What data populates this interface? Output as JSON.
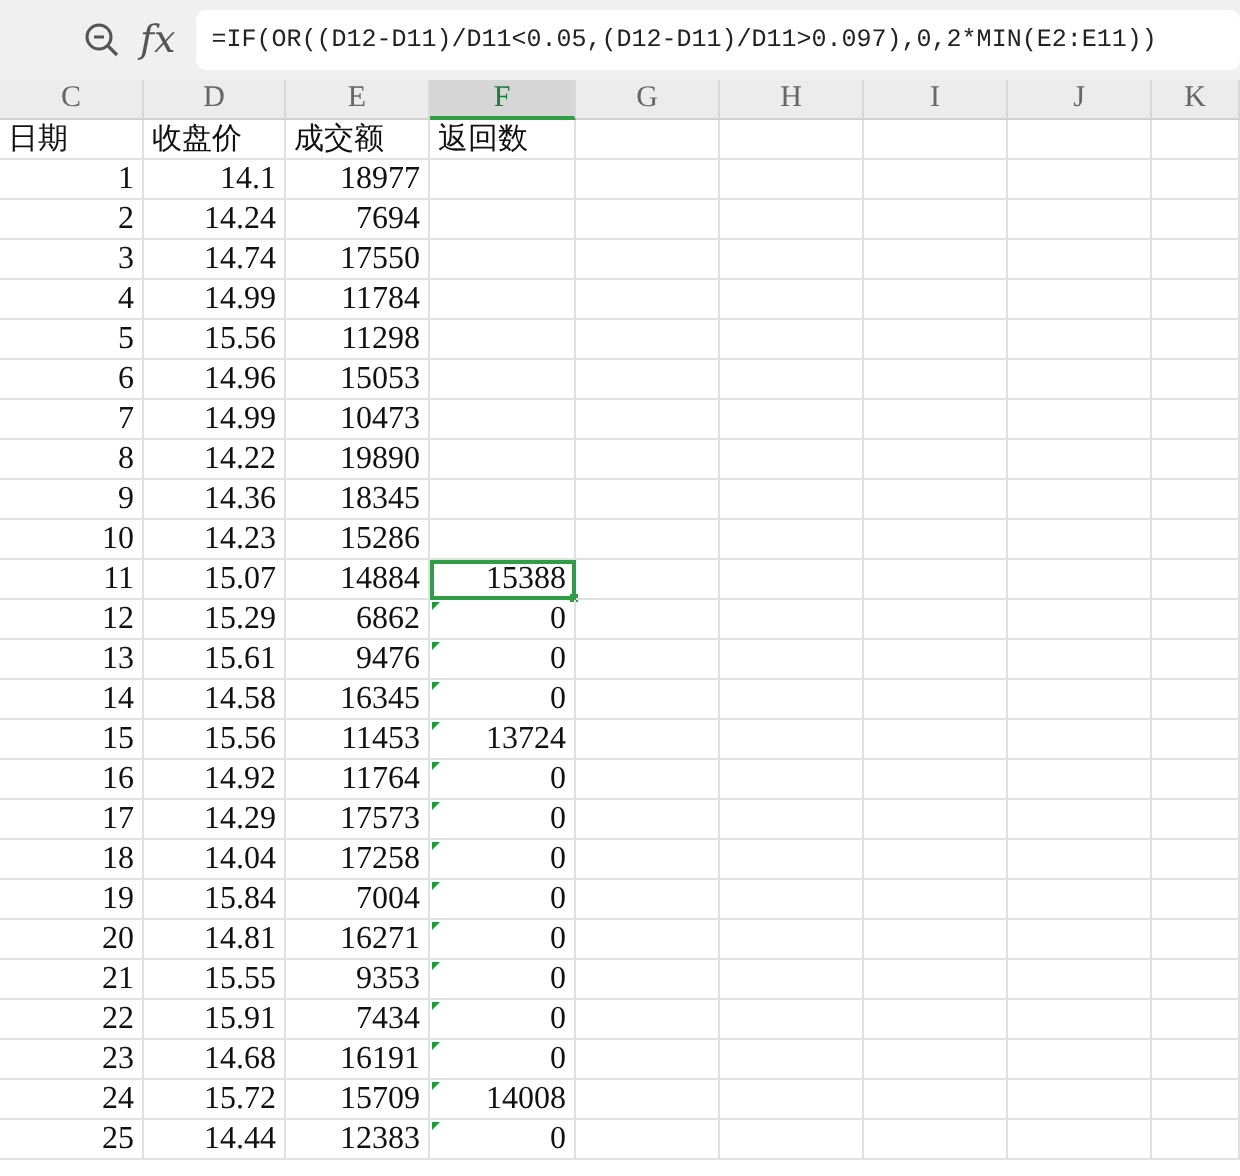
{
  "formula_bar": {
    "function_label": "fx",
    "formula": "=IF(OR((D12-D11)/D11<0.05,(D12-D11)/D11>0.097),0,2*MIN(E2:E11))"
  },
  "columns": [
    {
      "label": "C",
      "selected": false
    },
    {
      "label": "D",
      "selected": false
    },
    {
      "label": "E",
      "selected": false
    },
    {
      "label": "F",
      "selected": true
    },
    {
      "label": "G",
      "selected": false
    },
    {
      "label": "H",
      "selected": false
    },
    {
      "label": "I",
      "selected": false
    },
    {
      "label": "J",
      "selected": false
    },
    {
      "label": "K",
      "selected": false
    }
  ],
  "headers": [
    "日期",
    "收盘价",
    "成交额",
    "返回数"
  ],
  "rows": [
    {
      "c": "1",
      "d": "14.1",
      "e": "18977",
      "selected": false,
      "error_flag": false
    },
    {
      "c": "2",
      "d": "14.24",
      "e": "7694",
      "selected": false,
      "error_flag": false
    },
    {
      "c": "3",
      "d": "14.74",
      "e": "17550",
      "selected": false,
      "error_flag": false
    },
    {
      "c": "4",
      "d": "14.99",
      "e": "11784",
      "selected": false,
      "error_flag": false
    },
    {
      "c": "5",
      "d": "15.56",
      "e": "11298",
      "selected": false,
      "error_flag": false
    },
    {
      "c": "6",
      "d": "14.96",
      "e": "15053",
      "selected": false,
      "error_flag": false
    },
    {
      "c": "7",
      "d": "14.99",
      "e": "10473",
      "selected": false,
      "error_flag": false
    },
    {
      "c": "8",
      "d": "14.22",
      "e": "19890",
      "selected": false,
      "error_flag": false
    },
    {
      "c": "9",
      "d": "14.36",
      "e": "18345",
      "selected": false,
      "error_flag": false
    },
    {
      "c": "10",
      "d": "14.23",
      "e": "15286",
      "selected": false,
      "error_flag": false
    },
    {
      "c": "11",
      "d": "15.07",
      "e": "14884",
      "f": "15388",
      "selected": true,
      "error_flag": false
    },
    {
      "c": "12",
      "d": "15.29",
      "e": "6862",
      "f": "0",
      "selected": false,
      "error_flag": true
    },
    {
      "c": "13",
      "d": "15.61",
      "e": "9476",
      "f": "0",
      "selected": false,
      "error_flag": true
    },
    {
      "c": "14",
      "d": "14.58",
      "e": "16345",
      "f": "0",
      "selected": false,
      "error_flag": true
    },
    {
      "c": "15",
      "d": "15.56",
      "e": "11453",
      "f": "13724",
      "selected": false,
      "error_flag": true
    },
    {
      "c": "16",
      "d": "14.92",
      "e": "11764",
      "f": "0",
      "selected": false,
      "error_flag": true
    },
    {
      "c": "17",
      "d": "14.29",
      "e": "17573",
      "f": "0",
      "selected": false,
      "error_flag": true
    },
    {
      "c": "18",
      "d": "14.04",
      "e": "17258",
      "f": "0",
      "selected": false,
      "error_flag": true
    },
    {
      "c": "19",
      "d": "15.84",
      "e": "7004",
      "f": "0",
      "selected": false,
      "error_flag": true
    },
    {
      "c": "20",
      "d": "14.81",
      "e": "16271",
      "f": "0",
      "selected": false,
      "error_flag": true
    },
    {
      "c": "21",
      "d": "15.55",
      "e": "9353",
      "f": "0",
      "selected": false,
      "error_flag": true
    },
    {
      "c": "22",
      "d": "15.91",
      "e": "7434",
      "f": "0",
      "selected": false,
      "error_flag": true
    },
    {
      "c": "23",
      "d": "14.68",
      "e": "16191",
      "f": "0",
      "selected": false,
      "error_flag": true
    },
    {
      "c": "24",
      "d": "15.72",
      "e": "15709",
      "f": "14008",
      "selected": false,
      "error_flag": true
    },
    {
      "c": "25",
      "d": "14.44",
      "e": "12383",
      "f": "0",
      "selected": false,
      "error_flag": true
    }
  ]
}
